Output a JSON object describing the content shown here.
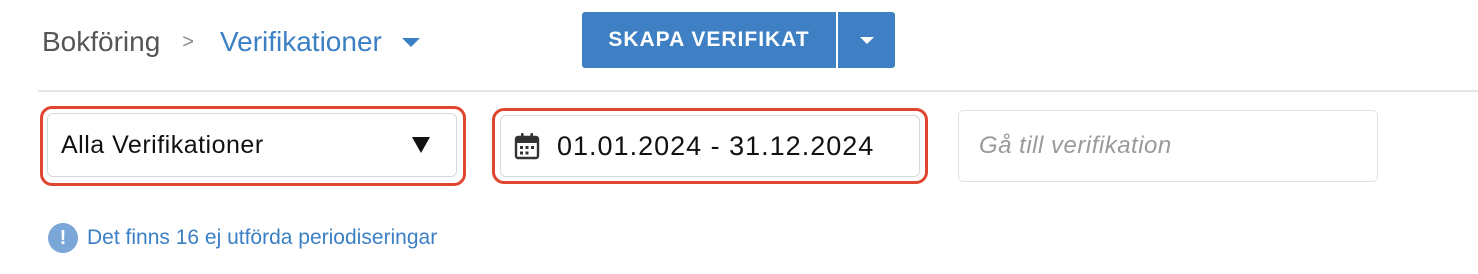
{
  "header": {
    "breadcrumb_root": "Bokföring",
    "breadcrumb_separator": ">",
    "breadcrumb_current": "Verifikationer",
    "current_dropdown_icon": "caret-down-icon"
  },
  "toolbar": {
    "create_button_label": "SKAPA VERIFIKAT",
    "create_dropdown_icon": "caret-down-icon"
  },
  "filters": {
    "type_select_value": "Alla Verifikationer",
    "type_select_icon": "triangle-down-icon",
    "date_range_value": "01.01.2024 - 31.12.2024",
    "date_range_icon": "calendar-icon",
    "goto_placeholder": "Gå till verifikation",
    "goto_value": ""
  },
  "notice": {
    "icon": "info-icon",
    "icon_glyph": "!",
    "text": "Det finns 16 ej utförda periodiseringar"
  },
  "colors": {
    "accent": "#3f7fc4",
    "link": "#3b7fc4",
    "highlight_border": "#e0452f",
    "info_icon_bg": "#7aa6d8"
  }
}
